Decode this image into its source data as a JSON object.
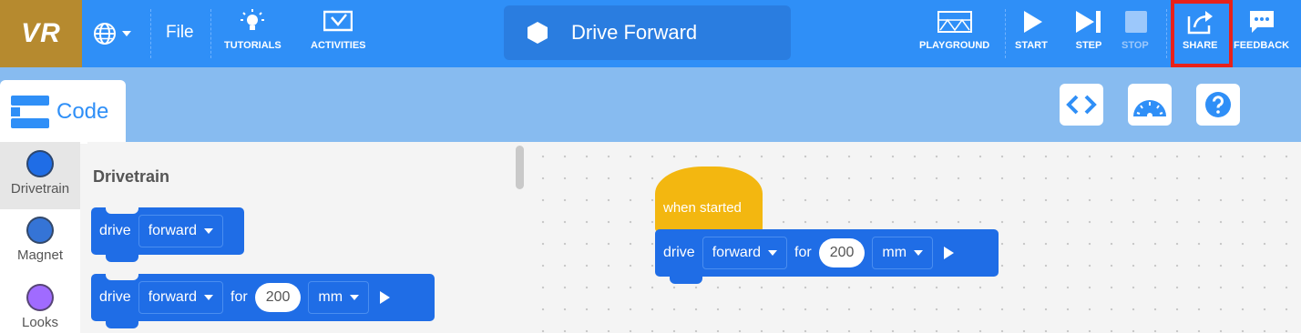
{
  "app": {
    "logo_text": "VR"
  },
  "toolbar": {
    "file_label": "File",
    "tutorials_label": "TUTORIALS",
    "activities_label": "ACTIVITIES",
    "project_title": "Drive Forward",
    "playground_label": "PLAYGROUND",
    "start_label": "START",
    "step_label": "STEP",
    "stop_label": "STOP",
    "share_label": "SHARE",
    "feedback_label": "FEEDBACK"
  },
  "tabs": {
    "code_label": "Code"
  },
  "categories": [
    {
      "label": "Drivetrain",
      "color": "#1f6de6",
      "selected": true
    },
    {
      "label": "Magnet",
      "color": "#3574d6",
      "selected": false
    },
    {
      "label": "Looks",
      "color": "#a06bff",
      "selected": false
    }
  ],
  "palette": {
    "title": "Drivetrain",
    "block1": {
      "keyword": "drive",
      "direction": "forward"
    },
    "block2": {
      "keyword": "drive",
      "direction": "forward",
      "for_label": "for",
      "distance": "200",
      "unit": "mm"
    }
  },
  "workspace": {
    "hat_label": "when started",
    "block": {
      "keyword": "drive",
      "direction": "forward",
      "for_label": "for",
      "distance": "200",
      "unit": "mm"
    }
  },
  "colors": {
    "topbar": "#2f8ff7",
    "logo_bg": "#b68a2f",
    "share_highlight": "#e8211a",
    "motion_block": "#1f6de6",
    "event_block": "#f3b710"
  }
}
